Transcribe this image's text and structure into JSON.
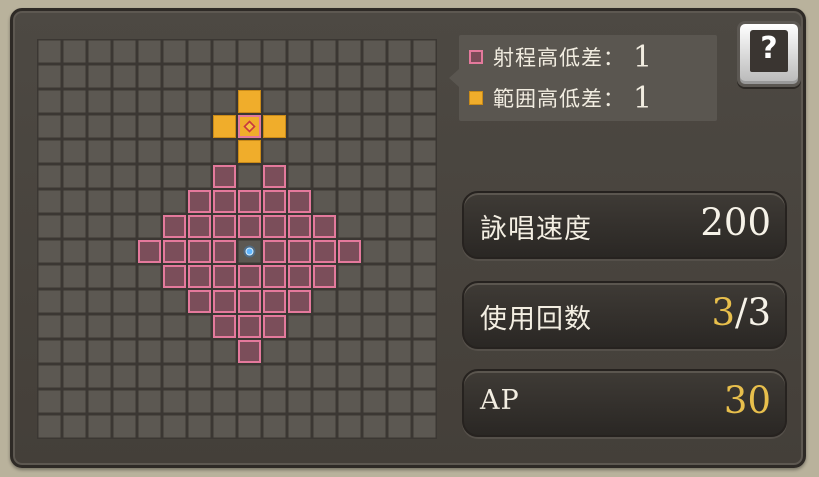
{
  "legend": {
    "range_elevation": {
      "label": "射程高低差：",
      "value": "1"
    },
    "aoe_elevation": {
      "label": "範囲高低差：",
      "value": "1"
    }
  },
  "help_button": {
    "label": "?"
  },
  "stats": {
    "cast_speed": {
      "label": "詠唱速度",
      "value": "200"
    },
    "uses": {
      "label": "使用回数",
      "current": "3",
      "separator": "/",
      "max": "3"
    },
    "ap": {
      "label": "AP",
      "value": "30"
    }
  },
  "colors": {
    "range_cell": "#e4799c",
    "aoe_cell": "#f0ad2b",
    "gold_text": "#e8bf4c"
  },
  "grid": {
    "cols": 16,
    "rows": 16,
    "caster": [
      8,
      8
    ],
    "range_cells": [
      [
        8,
        4
      ],
      [
        7,
        5
      ],
      [
        9,
        5
      ],
      [
        6,
        6
      ],
      [
        7,
        6
      ],
      [
        8,
        6
      ],
      [
        9,
        6
      ],
      [
        10,
        6
      ],
      [
        5,
        7
      ],
      [
        6,
        7
      ],
      [
        7,
        7
      ],
      [
        8,
        7
      ],
      [
        9,
        7
      ],
      [
        10,
        7
      ],
      [
        11,
        7
      ],
      [
        4,
        8
      ],
      [
        5,
        8
      ],
      [
        6,
        8
      ],
      [
        7,
        8
      ],
      [
        9,
        8
      ],
      [
        10,
        8
      ],
      [
        11,
        8
      ],
      [
        12,
        8
      ],
      [
        5,
        9
      ],
      [
        6,
        9
      ],
      [
        7,
        9
      ],
      [
        8,
        9
      ],
      [
        9,
        9
      ],
      [
        10,
        9
      ],
      [
        11,
        9
      ],
      [
        6,
        10
      ],
      [
        7,
        10
      ],
      [
        8,
        10
      ],
      [
        9,
        10
      ],
      [
        10,
        10
      ],
      [
        7,
        11
      ],
      [
        8,
        11
      ],
      [
        9,
        11
      ],
      [
        8,
        12
      ]
    ],
    "target": [
      8,
      3
    ],
    "aoe_cells": [
      [
        8,
        2
      ],
      [
        7,
        3
      ],
      [
        9,
        3
      ],
      [
        8,
        4
      ]
    ]
  }
}
